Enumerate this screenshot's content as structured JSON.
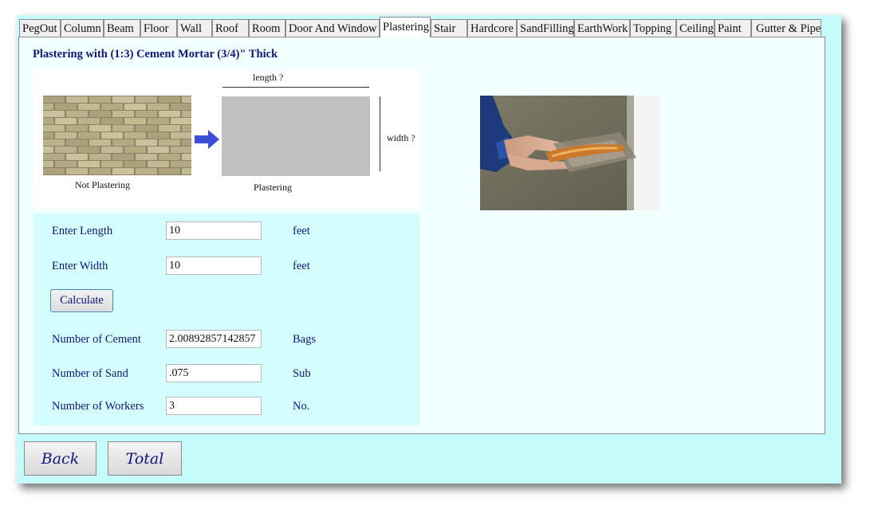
{
  "tabs": [
    {
      "label": "PegOut"
    },
    {
      "label": "Column"
    },
    {
      "label": "Beam"
    },
    {
      "label": "Floor"
    },
    {
      "label": "Wall"
    },
    {
      "label": "Roof"
    },
    {
      "label": "Room"
    },
    {
      "label": "Door And Window"
    },
    {
      "label": "Plastering"
    },
    {
      "label": "Stair"
    },
    {
      "label": "Hardcore"
    },
    {
      "label": "SandFilling"
    },
    {
      "label": "EarthWork"
    },
    {
      "label": "Topping"
    },
    {
      "label": "Ceiling"
    },
    {
      "label": "Paint"
    },
    {
      "label": "Gutter & Pipe"
    }
  ],
  "active_tab": "Plastering",
  "page_title": "Plastering with (1:3) Cement Mortar (3/4)\" Thick",
  "diagram": {
    "before_caption": "Not Plastering",
    "after_caption": "Plastering",
    "length_label": "length ?",
    "width_label": "width ?"
  },
  "form": {
    "length": {
      "label": "Enter Length",
      "value": "10",
      "unit": "feet"
    },
    "width": {
      "label": "Enter Width",
      "value": "10",
      "unit": "feet"
    },
    "calculate_label": "Calculate",
    "cement": {
      "label": "Number of Cement",
      "value": "2.00892857142857",
      "unit": "Bags"
    },
    "sand": {
      "label": "Number of Sand",
      "value": ".075",
      "unit": "Sub"
    },
    "workers": {
      "label": "Number of Workers",
      "value": "3",
      "unit": "No."
    }
  },
  "nav": {
    "back_label": "Back",
    "total_label": "Total"
  },
  "colors": {
    "window_bg": "#c6fbfb",
    "panel_bg": "#f2ffff",
    "label_text": "#10167a",
    "arrow": "#3b4fd6"
  }
}
